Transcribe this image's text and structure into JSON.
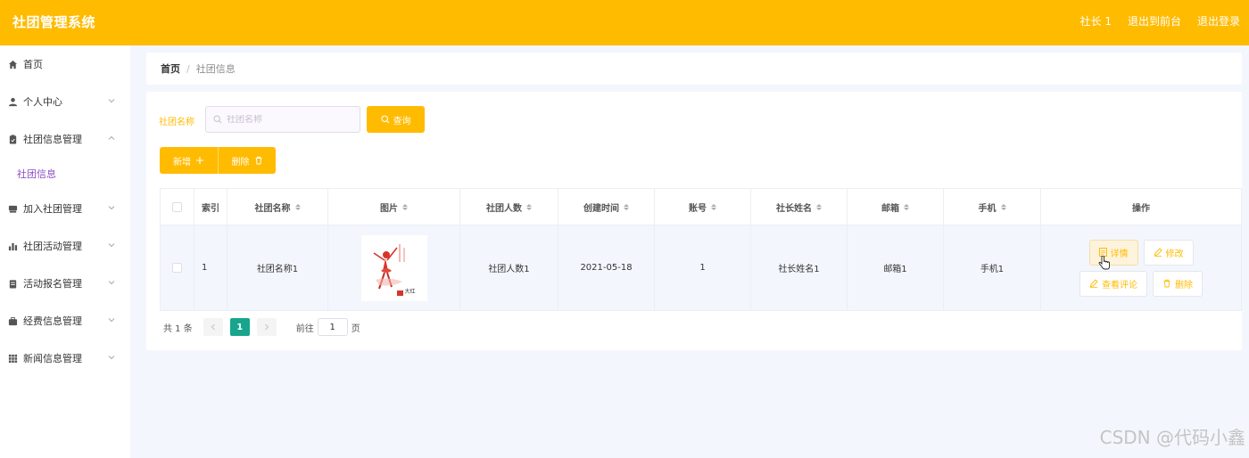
{
  "app": {
    "title": "社团管理系统"
  },
  "header": {
    "user_label": "社长 1",
    "front_label": "退出到前台",
    "logout_label": "退出登录"
  },
  "sidebar": {
    "items": [
      {
        "label": "首页",
        "icon": "home-icon"
      },
      {
        "label": "个人中心",
        "icon": "user-icon"
      },
      {
        "label": "社团信息管理",
        "icon": "clipboard-icon",
        "expanded": true,
        "children": [
          {
            "label": "社团信息",
            "active": true
          }
        ]
      },
      {
        "label": "加入社团管理",
        "icon": "folder-icon"
      },
      {
        "label": "社团活动管理",
        "icon": "bar-chart-icon"
      },
      {
        "label": "活动报名管理",
        "icon": "list-icon"
      },
      {
        "label": "经费信息管理",
        "icon": "briefcase-icon"
      },
      {
        "label": "新闻信息管理",
        "icon": "grid-icon"
      }
    ]
  },
  "breadcrumb": {
    "home": "首页",
    "sep": "/",
    "current": "社团信息"
  },
  "search": {
    "label": "社团名称",
    "placeholder": "社团名称",
    "value": "",
    "query_label": "查询"
  },
  "actions": {
    "add_label": "新增",
    "delete_label": "删除"
  },
  "table": {
    "columns": [
      "索引",
      "社团名称",
      "图片",
      "社团人数",
      "创建时间",
      "账号",
      "社长姓名",
      "邮箱",
      "手机",
      "操作"
    ],
    "rows": [
      {
        "index": "1",
        "name": "社团名称1",
        "image_caption": "大红",
        "members": "社团人数1",
        "created": "2021-05-18",
        "account": "1",
        "leader": "社长姓名1",
        "email": "邮箱1",
        "phone": "手机1"
      }
    ],
    "row_actions": {
      "detail": "详情",
      "edit": "修改",
      "comments": "查看评论",
      "delete": "删除"
    }
  },
  "pagination": {
    "total_label": "共 1 条",
    "current_page": "1",
    "goto_label": "前往",
    "goto_value": "1",
    "page_suffix": "页"
  },
  "watermark": "CSDN @代码小鑫",
  "colors": {
    "brand": "#ffbb00",
    "active_page": "#17a58d",
    "sub_active": "#8d4ec6"
  }
}
